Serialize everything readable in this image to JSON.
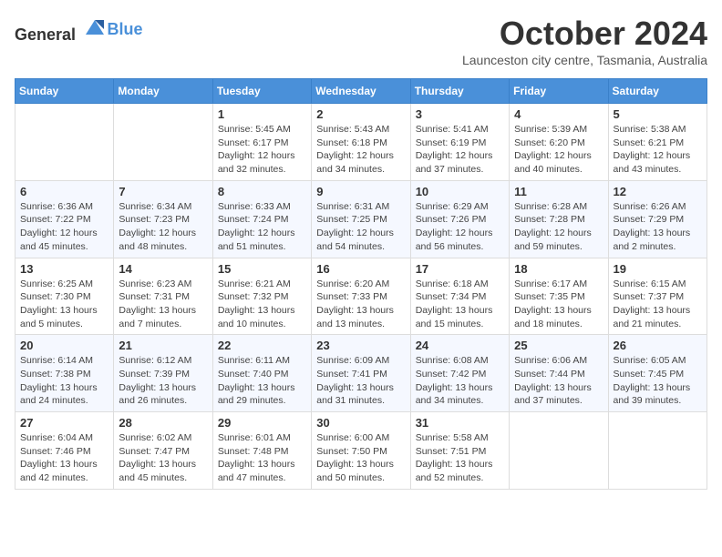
{
  "header": {
    "logo_general": "General",
    "logo_blue": "Blue",
    "month_title": "October 2024",
    "subtitle": "Launceston city centre, Tasmania, Australia"
  },
  "weekdays": [
    "Sunday",
    "Monday",
    "Tuesday",
    "Wednesday",
    "Thursday",
    "Friday",
    "Saturday"
  ],
  "weeks": [
    [
      {
        "day": "",
        "info": ""
      },
      {
        "day": "",
        "info": ""
      },
      {
        "day": "1",
        "info": "Sunrise: 5:45 AM\nSunset: 6:17 PM\nDaylight: 12 hours and 32 minutes."
      },
      {
        "day": "2",
        "info": "Sunrise: 5:43 AM\nSunset: 6:18 PM\nDaylight: 12 hours and 34 minutes."
      },
      {
        "day": "3",
        "info": "Sunrise: 5:41 AM\nSunset: 6:19 PM\nDaylight: 12 hours and 37 minutes."
      },
      {
        "day": "4",
        "info": "Sunrise: 5:39 AM\nSunset: 6:20 PM\nDaylight: 12 hours and 40 minutes."
      },
      {
        "day": "5",
        "info": "Sunrise: 5:38 AM\nSunset: 6:21 PM\nDaylight: 12 hours and 43 minutes."
      }
    ],
    [
      {
        "day": "6",
        "info": "Sunrise: 6:36 AM\nSunset: 7:22 PM\nDaylight: 12 hours and 45 minutes."
      },
      {
        "day": "7",
        "info": "Sunrise: 6:34 AM\nSunset: 7:23 PM\nDaylight: 12 hours and 48 minutes."
      },
      {
        "day": "8",
        "info": "Sunrise: 6:33 AM\nSunset: 7:24 PM\nDaylight: 12 hours and 51 minutes."
      },
      {
        "day": "9",
        "info": "Sunrise: 6:31 AM\nSunset: 7:25 PM\nDaylight: 12 hours and 54 minutes."
      },
      {
        "day": "10",
        "info": "Sunrise: 6:29 AM\nSunset: 7:26 PM\nDaylight: 12 hours and 56 minutes."
      },
      {
        "day": "11",
        "info": "Sunrise: 6:28 AM\nSunset: 7:28 PM\nDaylight: 12 hours and 59 minutes."
      },
      {
        "day": "12",
        "info": "Sunrise: 6:26 AM\nSunset: 7:29 PM\nDaylight: 13 hours and 2 minutes."
      }
    ],
    [
      {
        "day": "13",
        "info": "Sunrise: 6:25 AM\nSunset: 7:30 PM\nDaylight: 13 hours and 5 minutes."
      },
      {
        "day": "14",
        "info": "Sunrise: 6:23 AM\nSunset: 7:31 PM\nDaylight: 13 hours and 7 minutes."
      },
      {
        "day": "15",
        "info": "Sunrise: 6:21 AM\nSunset: 7:32 PM\nDaylight: 13 hours and 10 minutes."
      },
      {
        "day": "16",
        "info": "Sunrise: 6:20 AM\nSunset: 7:33 PM\nDaylight: 13 hours and 13 minutes."
      },
      {
        "day": "17",
        "info": "Sunrise: 6:18 AM\nSunset: 7:34 PM\nDaylight: 13 hours and 15 minutes."
      },
      {
        "day": "18",
        "info": "Sunrise: 6:17 AM\nSunset: 7:35 PM\nDaylight: 13 hours and 18 minutes."
      },
      {
        "day": "19",
        "info": "Sunrise: 6:15 AM\nSunset: 7:37 PM\nDaylight: 13 hours and 21 minutes."
      }
    ],
    [
      {
        "day": "20",
        "info": "Sunrise: 6:14 AM\nSunset: 7:38 PM\nDaylight: 13 hours and 24 minutes."
      },
      {
        "day": "21",
        "info": "Sunrise: 6:12 AM\nSunset: 7:39 PM\nDaylight: 13 hours and 26 minutes."
      },
      {
        "day": "22",
        "info": "Sunrise: 6:11 AM\nSunset: 7:40 PM\nDaylight: 13 hours and 29 minutes."
      },
      {
        "day": "23",
        "info": "Sunrise: 6:09 AM\nSunset: 7:41 PM\nDaylight: 13 hours and 31 minutes."
      },
      {
        "day": "24",
        "info": "Sunrise: 6:08 AM\nSunset: 7:42 PM\nDaylight: 13 hours and 34 minutes."
      },
      {
        "day": "25",
        "info": "Sunrise: 6:06 AM\nSunset: 7:44 PM\nDaylight: 13 hours and 37 minutes."
      },
      {
        "day": "26",
        "info": "Sunrise: 6:05 AM\nSunset: 7:45 PM\nDaylight: 13 hours and 39 minutes."
      }
    ],
    [
      {
        "day": "27",
        "info": "Sunrise: 6:04 AM\nSunset: 7:46 PM\nDaylight: 13 hours and 42 minutes."
      },
      {
        "day": "28",
        "info": "Sunrise: 6:02 AM\nSunset: 7:47 PM\nDaylight: 13 hours and 45 minutes."
      },
      {
        "day": "29",
        "info": "Sunrise: 6:01 AM\nSunset: 7:48 PM\nDaylight: 13 hours and 47 minutes."
      },
      {
        "day": "30",
        "info": "Sunrise: 6:00 AM\nSunset: 7:50 PM\nDaylight: 13 hours and 50 minutes."
      },
      {
        "day": "31",
        "info": "Sunrise: 5:58 AM\nSunset: 7:51 PM\nDaylight: 13 hours and 52 minutes."
      },
      {
        "day": "",
        "info": ""
      },
      {
        "day": "",
        "info": ""
      }
    ]
  ]
}
